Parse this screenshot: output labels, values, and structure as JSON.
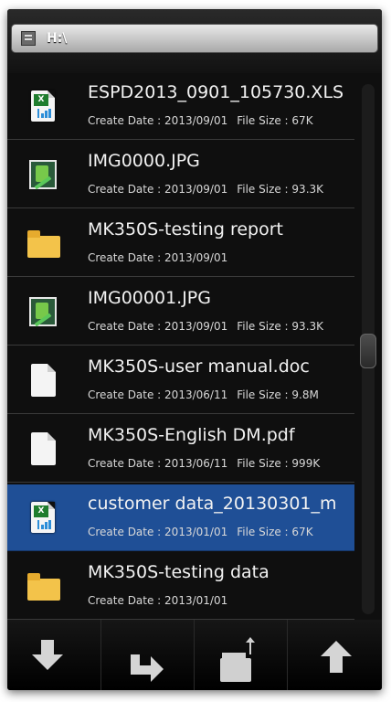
{
  "path": {
    "text": "H:\\"
  },
  "labels": {
    "create_prefix": "Create Date : ",
    "size_prefix": "File Size : "
  },
  "files": [
    {
      "name": "ESPD2013_0901_105730.XLS",
      "type": "xls-icon",
      "date": "2013/09/01",
      "size": "67K",
      "selected": false
    },
    {
      "name": "IMG0000.JPG",
      "type": "image-icon",
      "date": "2013/09/01",
      "size": "93.3K",
      "selected": false
    },
    {
      "name": "MK350S-testing report",
      "type": "folder-icon",
      "date": "2013/09/01",
      "size": null,
      "selected": false
    },
    {
      "name": "IMG00001.JPG",
      "type": "image-icon",
      "date": "2013/09/01",
      "size": "93.3K",
      "selected": false
    },
    {
      "name": "MK350S-user manual.doc",
      "type": "document-icon",
      "date": "2013/06/11",
      "size": "9.8M",
      "selected": false
    },
    {
      "name": "MK350S-English DM.pdf",
      "type": "document-icon",
      "date": "2013/06/11",
      "size": "999K",
      "selected": false
    },
    {
      "name": "customer data_20130301_m",
      "type": "xls-icon",
      "date": "2013/01/01",
      "size": "67K",
      "selected": true
    },
    {
      "name": "MK350S-testing data",
      "type": "folder-icon",
      "date": "2013/01/01",
      "size": null,
      "selected": false
    }
  ],
  "toolbar": {
    "buttons": [
      "download-arrow-icon",
      "return-arrow-icon",
      "move-folder-icon",
      "up-arrow-icon"
    ]
  },
  "colors": {
    "selected_row": "#1f4f96",
    "background": "#0f0f0f"
  }
}
